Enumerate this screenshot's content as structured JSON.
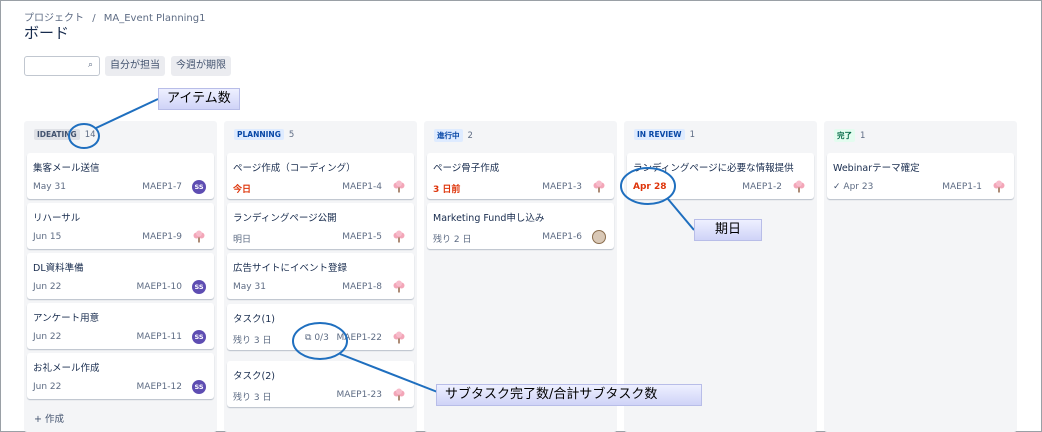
{
  "breadcrumb": {
    "root": "プロジェクト",
    "sep": "/",
    "project": "MA_Event Planning1"
  },
  "page_title": "ボード",
  "filters": {
    "mine": "自分が担当",
    "due_this_week": "今週が期限"
  },
  "columns": [
    {
      "name": "IDEATING",
      "count": "14",
      "cards": [
        {
          "title": "集客メール送信",
          "due": "May 31",
          "key": "MAEP1-7",
          "avatar": "SS"
        },
        {
          "title": "リハーサル",
          "due": "Jun 15",
          "key": "MAEP1-9",
          "avatar": "tree"
        },
        {
          "title": "DL資料準備",
          "due": "Jun 22",
          "key": "MAEP1-10",
          "avatar": "SS"
        },
        {
          "title": "アンケート用意",
          "due": "Jun 22",
          "key": "MAEP1-11",
          "avatar": "SS"
        },
        {
          "title": "お礼メール作成",
          "due": "Jun 22",
          "key": "MAEP1-12",
          "avatar": "SS"
        }
      ],
      "create": "作成"
    },
    {
      "name": "PLANNING",
      "count": "5",
      "cards": [
        {
          "title": "ページ作成（コーディング）",
          "due": "今日",
          "key": "MAEP1-4"
        },
        {
          "title": "ランディングページ公開",
          "due": "明日",
          "key": "MAEP1-5"
        },
        {
          "title": "広告サイトにイベント登録",
          "due": "May 31",
          "key": "MAEP1-8"
        },
        {
          "title": "タスク(1)",
          "due": "残り 3 日",
          "subtasks": "0/3",
          "key": "MAEP1-22"
        },
        {
          "title": "タスク(2)",
          "due": "残り 3 日",
          "key": "MAEP1-23"
        }
      ]
    },
    {
      "name": "進行中",
      "count": "2",
      "cards": [
        {
          "title": "ページ骨子作成",
          "due": "3 日前",
          "key": "MAEP1-3"
        },
        {
          "title": "Marketing Fund申し込み",
          "due": "残り 2 日",
          "key": "MAEP1-6"
        }
      ]
    },
    {
      "name": "IN REVIEW",
      "count": "1",
      "cards": [
        {
          "title": "ランディングページに必要な情報提供",
          "due": "Apr 28",
          "key": "MAEP1-2"
        }
      ]
    },
    {
      "name": "完了",
      "count": "1",
      "cards": [
        {
          "title": "Webinarテーマ確定",
          "due": "Apr 23",
          "key": "MAEP1-1"
        }
      ]
    }
  ],
  "annotations": {
    "item_count": "アイテム数",
    "due_date": "期日",
    "subtasks": "サブタスク完了数/合計サブタスク数"
  },
  "colors": {
    "purple_avatar": "#5e4db2",
    "annotation_blue": "#1f6fbf",
    "overdue_red": "#de350b"
  }
}
